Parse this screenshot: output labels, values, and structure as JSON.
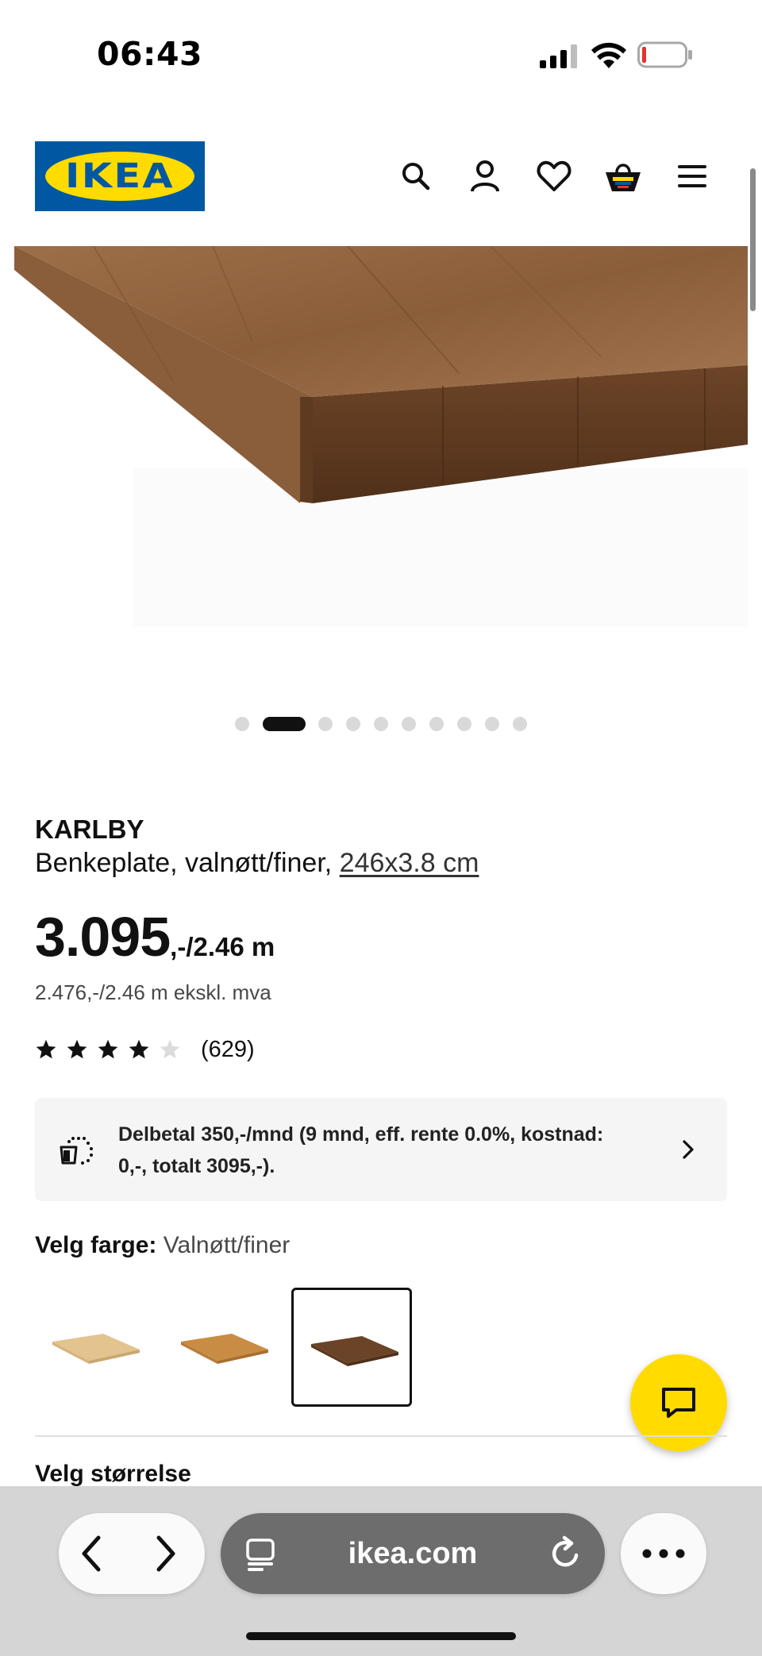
{
  "status_bar": {
    "time": "06:43"
  },
  "header": {
    "logo_text": "IKEA",
    "icons": [
      "search-icon",
      "account-icon",
      "heart-icon",
      "cart-icon",
      "menu-icon"
    ]
  },
  "gallery": {
    "image_count": 10,
    "active_index": 1
  },
  "product": {
    "name": "KARLBY",
    "description": "Benkeplate, valnøtt/finer,",
    "size": "246x3.8 cm",
    "price_main": "3.095",
    "price_unit": ",-/2.46 m",
    "price_ex_vat": "2.476,-/2.46 m ekskl. mva",
    "rating_value": 4,
    "rating_max": 5,
    "review_count": "(629)"
  },
  "installment": {
    "text": "Delbetal 350,-/mnd (9 mnd, eff. rente 0.0%, kostnad: 0,-, totalt 3095,-)."
  },
  "color_picker": {
    "label": "Velg farge:",
    "selected_value": "Valnøtt/finer",
    "options": [
      {
        "name": "light-oak",
        "color": "#e3c48f"
      },
      {
        "name": "oak",
        "color": "#c98c44"
      },
      {
        "name": "walnut",
        "color": "#6b4326"
      }
    ],
    "selected_index": 2
  },
  "size_picker": {
    "label": "Velg størrelse"
  },
  "browser": {
    "url": "ikea.com"
  },
  "colors": {
    "ikea_blue": "#0058a3",
    "ikea_yellow": "#ffdb00",
    "text": "#111111",
    "panel_bg": "#f5f5f5"
  }
}
